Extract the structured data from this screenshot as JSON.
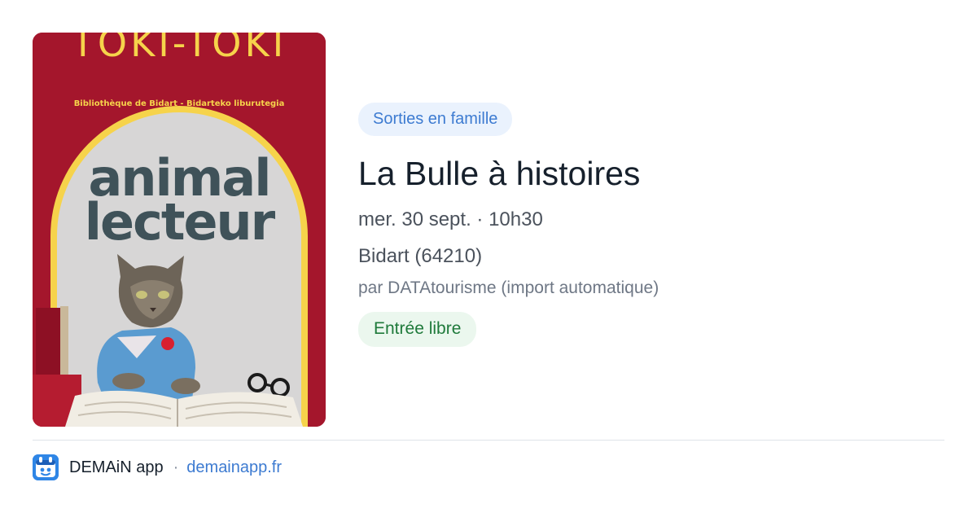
{
  "poster": {
    "header_text": "TOKI-TOKI",
    "subtitle": "Bibliothèque de Bidart - Bidarteko liburutegia",
    "title_line1": "animal",
    "title_line2": "lecteur",
    "colors": {
      "background": "#a4162c",
      "accent": "#f6d34b",
      "title": "#3f5259"
    }
  },
  "event": {
    "category": "Sorties en famille",
    "title": "La Bulle à histoires",
    "date": "mer. 30 sept. · 10h30",
    "place": "Bidart (64210)",
    "source": "par DATAtourisme (import automatique)",
    "price": "Entrée libre"
  },
  "footer": {
    "app_icon": "demain-app-icon",
    "app_name": "DEMAiN app",
    "separator": "·",
    "site": "demainapp.fr"
  },
  "colors": {
    "category_bg": "#eaf2fd",
    "category_text": "#3d7bd1",
    "price_bg": "#ebf7ee",
    "price_text": "#1f7a3b",
    "title_text": "#16202c"
  }
}
